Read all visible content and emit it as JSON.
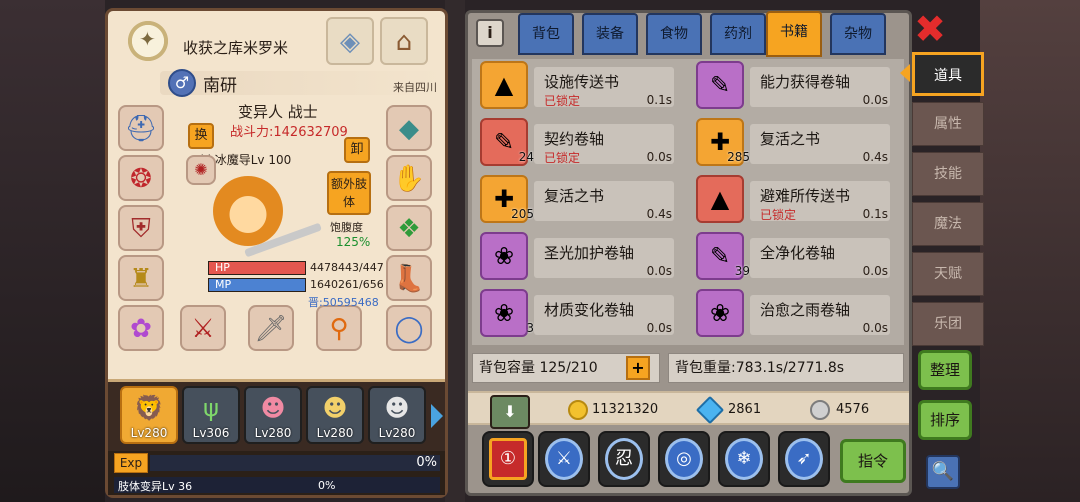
{
  "character": {
    "title": "收获之库米罗米",
    "name": "南研",
    "gender_symbol": "♂",
    "origin": "来自四川",
    "class": "变异人 战士",
    "power_label": "战斗力:142632709",
    "skill": "Skl 冰魔导Lv 100",
    "swap_btn": "换",
    "unequip_btn": "卸",
    "extra_btn": "额外肢体",
    "satiety_label": "饱腹度",
    "satiety_value": "125%",
    "hp_label": "HP",
    "hp_value": "4478443/447",
    "mp_label": "MP",
    "mp_value": "1640261/656",
    "gold_text": "晋:50595468"
  },
  "party": [
    {
      "lv": "Lv280",
      "icon": "lion-hero-icon"
    },
    {
      "lv": "Lv306",
      "icon": "horns-icon"
    },
    {
      "lv": "Lv280",
      "icon": "pink-girl-icon"
    },
    {
      "lv": "Lv280",
      "icon": "blonde-girl-icon"
    },
    {
      "lv": "Lv280",
      "icon": "white-hair-icon"
    }
  ],
  "exp": {
    "badge": "Exp",
    "pct": "0%",
    "sub_label": "肢体变异Lv 36",
    "sub_pct": "0%"
  },
  "tabs": [
    "背包",
    "装备",
    "食物",
    "药剂",
    "书籍",
    "杂物"
  ],
  "active_tab": "书籍",
  "info_btn": "i",
  "items": [
    {
      "name": "设施传送书",
      "locked": "已锁定",
      "weight": "0.1s",
      "count": "",
      "color": "orange",
      "glyph": "▲"
    },
    {
      "name": "能力获得卷轴",
      "locked": "",
      "weight": "0.0s",
      "count": "",
      "color": "purple",
      "glyph": "✎"
    },
    {
      "name": "契约卷轴",
      "locked": "已锁定",
      "weight": "0.0s",
      "count": "24",
      "color": "red",
      "glyph": "✎"
    },
    {
      "name": "复活之书",
      "locked": "",
      "weight": "0.4s",
      "count": "285",
      "color": "orange",
      "glyph": "✚"
    },
    {
      "name": "复活之书",
      "locked": "",
      "weight": "0.4s",
      "count": "205",
      "color": "orange",
      "glyph": "✚"
    },
    {
      "name": "避难所传送书",
      "locked": "已锁定",
      "weight": "0.1s",
      "count": "",
      "color": "red",
      "glyph": "▲"
    },
    {
      "name": "圣光加护卷轴",
      "locked": "",
      "weight": "0.0s",
      "count": "",
      "color": "purple",
      "glyph": "❀"
    },
    {
      "name": "全净化卷轴",
      "locked": "",
      "weight": "0.0s",
      "count": "39",
      "color": "purple",
      "glyph": "✎"
    },
    {
      "name": "材质变化卷轴",
      "locked": "",
      "weight": "0.0s",
      "count": "3",
      "color": "purple",
      "glyph": "❀"
    },
    {
      "name": "治愈之雨卷轴",
      "locked": "",
      "weight": "0.0s",
      "count": "",
      "color": "purple",
      "glyph": "❀"
    }
  ],
  "bag": {
    "capacity": "背包容量 125/210",
    "weight": "背包重量:783.1s/2771.8s",
    "plus": "+"
  },
  "currency": {
    "gold": "11321320",
    "gems": "2861",
    "silver": "4576"
  },
  "actions": [
    {
      "name": "order-icon",
      "glyph": "①"
    },
    {
      "name": "axe-skill-icon",
      "glyph": "⚔"
    },
    {
      "name": "ninja-skill-icon",
      "glyph": "忍"
    },
    {
      "name": "ring-skill-icon",
      "glyph": "◎"
    },
    {
      "name": "snow-skill-icon",
      "glyph": "❄"
    },
    {
      "name": "wing-skill-icon",
      "glyph": "➶"
    }
  ],
  "command_btn": "指令",
  "side_tabs": [
    "道具",
    "属性",
    "技能",
    "魔法",
    "天赋",
    "乐团"
  ],
  "sort_btn": "整理",
  "order_btn": "排序",
  "close_glyph": "✖",
  "search_glyph": "🔍"
}
